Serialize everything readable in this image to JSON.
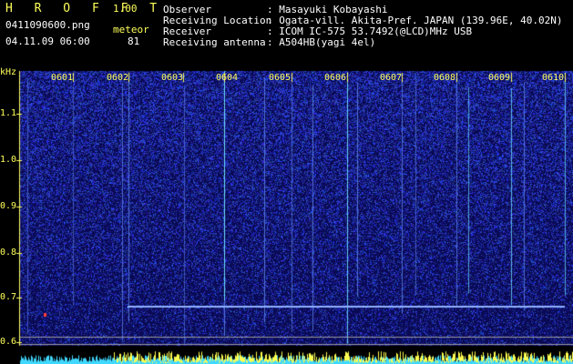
{
  "app": {
    "name": "H R O F F T",
    "version": "1.00",
    "filename": "0411090600.png",
    "datetime": "04.11.09 06:00",
    "meteor_label": "meteor",
    "meteor_count": "81"
  },
  "info": {
    "observer_label": "Observer",
    "observer_value": ": Masayuki Kobayashi",
    "location_label": "Receiving Location",
    "location_value": ": Ogata-vill. Akita-Pref. JAPAN (139.96E, 40.02N)",
    "receiver_label": "Receiver",
    "receiver_value": ": ICOM IC-575 53.7492(@LCD)MHz USB",
    "antenna_label": "Receiving antenna",
    "antenna_value": ": A504HB(yagi 4el)"
  },
  "axis": {
    "unit": "kHz",
    "y_ticks": [
      "1.1",
      "1.0",
      "0.9",
      "0.8",
      "0.7",
      "0.6"
    ],
    "x_ticks": [
      "0601",
      "0602",
      "0603",
      "0604",
      "0605",
      "0606",
      "0607",
      "0608",
      "0609",
      "0610"
    ]
  },
  "colors": {
    "label_yellow": "#ffff5a",
    "background_blue": "#0a0a55",
    "noise_blue": "#2a3cc8",
    "meteor_cyan": "#6fe0ff",
    "carrier_line": "#8fb0ff",
    "bottom_yellow": "#ffff50",
    "bottom_cyan": "#40d8ff"
  }
}
